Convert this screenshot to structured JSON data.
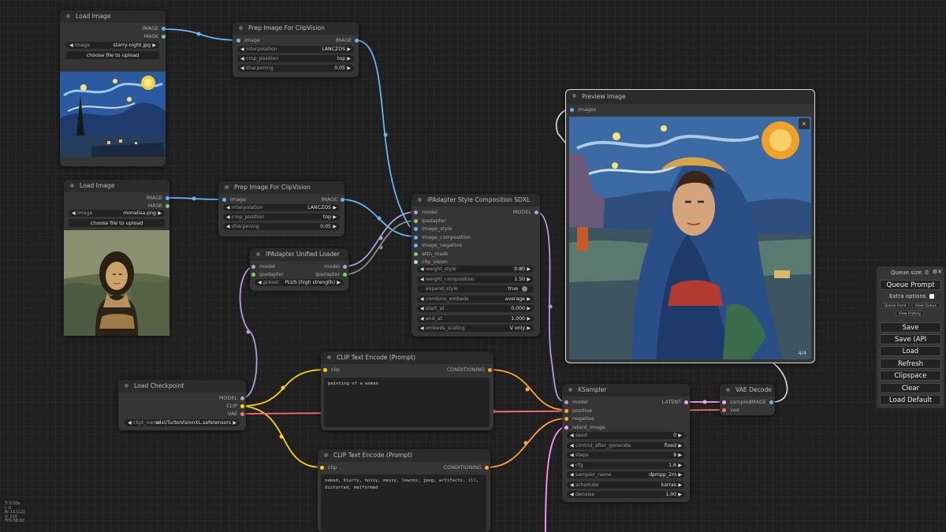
{
  "nodes": {
    "load_image_1": {
      "title": "Load Image",
      "outputs": [
        "IMAGE",
        "MASK"
      ],
      "image_label": "image",
      "image_value": "starry-night.jpg",
      "upload_label": "choose file to upload"
    },
    "prep_1": {
      "title": "Prep Image For ClipVision",
      "input": "image",
      "output": "IMAGE",
      "widgets": [
        {
          "label": "interpolation",
          "value": "LANCZOS"
        },
        {
          "label": "crop_position",
          "value": "top"
        },
        {
          "label": "sharpening",
          "value": "0.05"
        }
      ]
    },
    "load_image_2": {
      "title": "Load Image",
      "outputs": [
        "IMAGE",
        "MASK"
      ],
      "image_label": "image",
      "image_value": "monalisa.png",
      "upload_label": "choose file to upload"
    },
    "prep_2": {
      "title": "Prep Image For ClipVision",
      "input": "image",
      "output": "IMAGE",
      "widgets": [
        {
          "label": "interpolation",
          "value": "LANCZOS"
        },
        {
          "label": "crop_position",
          "value": "top"
        },
        {
          "label": "sharpening",
          "value": "0.05"
        }
      ]
    },
    "unified_loader": {
      "title": "IPAdapter Unified Loader",
      "inputs": [
        "model",
        "ipadapter"
      ],
      "outputs": [
        "model",
        "ipadapter"
      ],
      "preset_label": "preset",
      "preset_value": "PLUS (high strength)"
    },
    "style_comp": {
      "title": "IPAdapter Style Composition SDXL",
      "output": "MODEL",
      "inputs": [
        "model",
        "ipadapter",
        "image_style",
        "image_composition",
        "image_negative",
        "attn_mask",
        "clip_vision"
      ],
      "widgets": [
        {
          "label": "weight_style",
          "value": "0.80"
        },
        {
          "label": "weight_composition",
          "value": "1.50"
        },
        {
          "label": "expand_style",
          "value": "true"
        },
        {
          "label": "combine_embeds",
          "value": "average"
        },
        {
          "label": "start_at",
          "value": "0.000"
        },
        {
          "label": "end_at",
          "value": "1.000"
        },
        {
          "label": "embeds_scaling",
          "value": "V only"
        }
      ]
    },
    "preview": {
      "title": "Preview Image",
      "input": "images",
      "counter": "4/4",
      "close": "x"
    },
    "clip_pos": {
      "title": "CLIP Text Encode (Prompt)",
      "input": "clip",
      "output": "CONDITIONING",
      "text": "painting of a woman"
    },
    "clip_neg": {
      "title": "CLIP Text Encode (Prompt)",
      "input": "clip",
      "output": "CONDITIONING",
      "text": "naked, blurry, noisy, messy, lowres, jpeg, artifacts, ill, distorted, malformed"
    },
    "checkpoint": {
      "title": "Load Checkpoint",
      "outputs": [
        "MODEL",
        "CLIP",
        "VAE"
      ],
      "ckpt_label": "ckpt_name",
      "ckpt_value": "sdxl/TurboVisionXL.safetensors"
    },
    "ksampler": {
      "title": "KSampler",
      "output": "LATENT",
      "inputs": [
        "model",
        "positive",
        "negative",
        "latent_image"
      ],
      "widgets": [
        {
          "label": "seed",
          "value": "0"
        },
        {
          "label": "control_after_generate",
          "value": "fixed"
        },
        {
          "label": "steps",
          "value": "8"
        },
        {
          "label": "cfg",
          "value": "1.6"
        },
        {
          "label": "sampler_name",
          "value": "dpmpp_2m"
        },
        {
          "label": "scheduler",
          "value": "karras"
        },
        {
          "label": "denoise",
          "value": "1.00"
        }
      ]
    },
    "vae_decode": {
      "title": "VAE Decode",
      "inputs": [
        "samples",
        "vae"
      ],
      "output": "IMAGE"
    }
  },
  "panel": {
    "queue_size": "Queue size: 0",
    "queue_prompt": "Queue Prompt",
    "extra_options": "Extra options",
    "queue_front": "Queue Front",
    "view_queue": "View Queue",
    "view_history": "View History",
    "buttons": [
      "Save",
      "Save (API Format)",
      "Load",
      "Refresh",
      "Clipspace",
      "Clear",
      "Load Default"
    ]
  },
  "stats": [
    "T: 0.00s",
    "I: 0",
    "N: 11 [12]",
    "V: 103",
    "FPS:58.82"
  ],
  "colors": {
    "image": "#64b5f6",
    "model": "#b39ddb",
    "clip": "#ffd500",
    "conditioning": "#ffa931",
    "vae": "#ff6e6e",
    "latent": "#ff9cf9",
    "ipadapter": "#7bd66a",
    "mask": "#81c784"
  }
}
